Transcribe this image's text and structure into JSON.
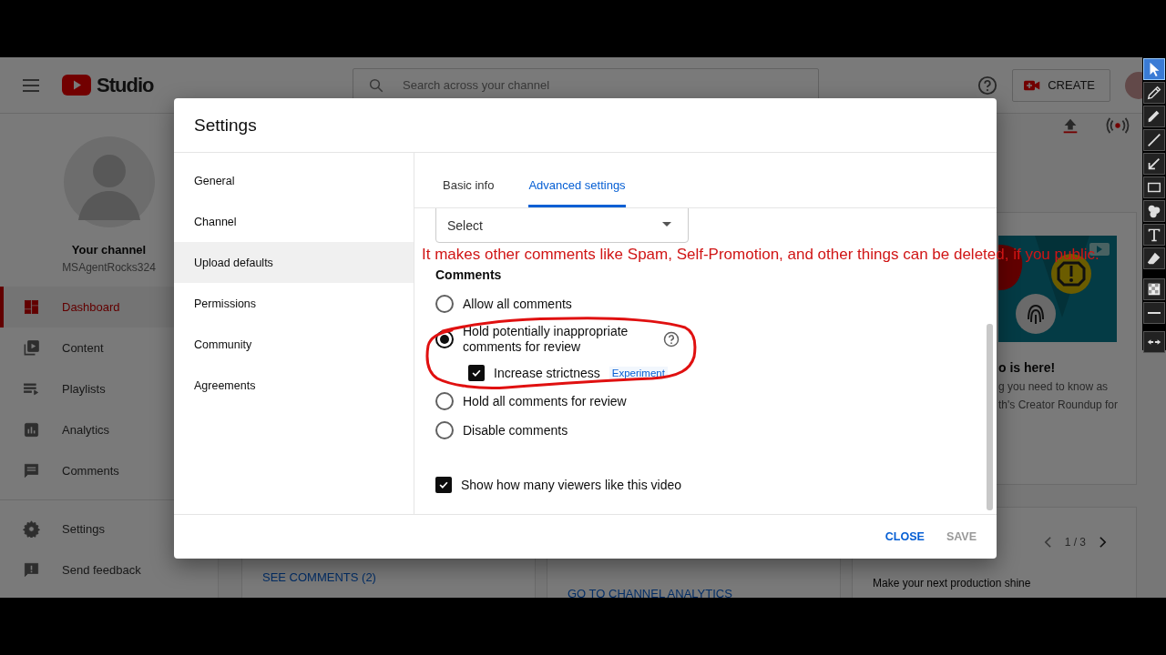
{
  "header": {
    "logo_text": "Studio",
    "search": {
      "placeholder": "Search across your channel"
    },
    "create_button": "CREATE"
  },
  "sidebar": {
    "channel_label": "Your channel",
    "channel_name": "MSAgentRocks324",
    "items": [
      {
        "label": "Dashboard",
        "kind": "dashboard",
        "selected": true
      },
      {
        "label": "Content",
        "kind": "content",
        "selected": false
      },
      {
        "label": "Playlists",
        "kind": "playlists",
        "selected": false
      },
      {
        "label": "Analytics",
        "kind": "analytics",
        "selected": false
      },
      {
        "label": "Comments",
        "kind": "comments",
        "selected": false
      }
    ],
    "footer_items": [
      {
        "label": "Settings",
        "kind": "settings"
      },
      {
        "label": "Send feedback",
        "kind": "feedback"
      }
    ]
  },
  "dashboard": {
    "news_card": {
      "heading": "o is here!",
      "lines": [
        "g you need to know as",
        "th's Creator Roundup for"
      ]
    },
    "pager": "1 / 3",
    "tip": "Make your next production shine",
    "links": [
      "SEE COMMENTS (2)",
      "GO TO CHANNEL ANALYTICS"
    ]
  },
  "dialog": {
    "title": "Settings",
    "nav": [
      {
        "label": "General",
        "selected": false
      },
      {
        "label": "Channel",
        "selected": false
      },
      {
        "label": "Upload defaults",
        "selected": true
      },
      {
        "label": "Permissions",
        "selected": false
      },
      {
        "label": "Community",
        "selected": false
      },
      {
        "label": "Agreements",
        "selected": false
      }
    ],
    "tabs": [
      {
        "label": "Basic info",
        "selected": false
      },
      {
        "label": "Advanced settings",
        "selected": true
      }
    ],
    "language_select": {
      "value": "Select"
    },
    "comments": {
      "heading": "Comments",
      "options": [
        {
          "label": "Allow all comments",
          "selected": false,
          "help": false
        },
        {
          "label": "Hold potentially inappropriate comments for review",
          "selected": true,
          "help": true,
          "sub_option": {
            "label": "Increase strictness",
            "checked": true,
            "badge": "Experiment"
          }
        },
        {
          "label": "Hold all comments for review",
          "selected": false,
          "help": false
        },
        {
          "label": "Disable comments",
          "selected": false,
          "help": false
        }
      ]
    },
    "show_likes": {
      "label": "Show how many viewers like this video",
      "checked": true
    },
    "buttons": [
      {
        "label": "CLOSE",
        "disabled": false
      },
      {
        "label": "SAVE",
        "disabled": true
      }
    ]
  },
  "annotation": {
    "text": "It makes other comments like Spam, Self-Promotion, and other things can be deleted, if you public."
  },
  "drawing_toolbar": {
    "tools": [
      {
        "kind": "cursor",
        "selected": true
      },
      {
        "kind": "pencil",
        "selected": false
      },
      {
        "kind": "marker",
        "selected": false
      },
      {
        "kind": "line",
        "selected": false
      },
      {
        "kind": "arrow",
        "selected": false
      },
      {
        "kind": "rectangle",
        "selected": false
      },
      {
        "kind": "numbering",
        "selected": false
      },
      {
        "kind": "text",
        "selected": false
      },
      {
        "kind": "eraser",
        "selected": false
      },
      {
        "kind": "mosaic",
        "selected": false
      },
      {
        "kind": "thickness",
        "selected": false
      },
      {
        "kind": "collapse",
        "selected": false
      }
    ]
  }
}
